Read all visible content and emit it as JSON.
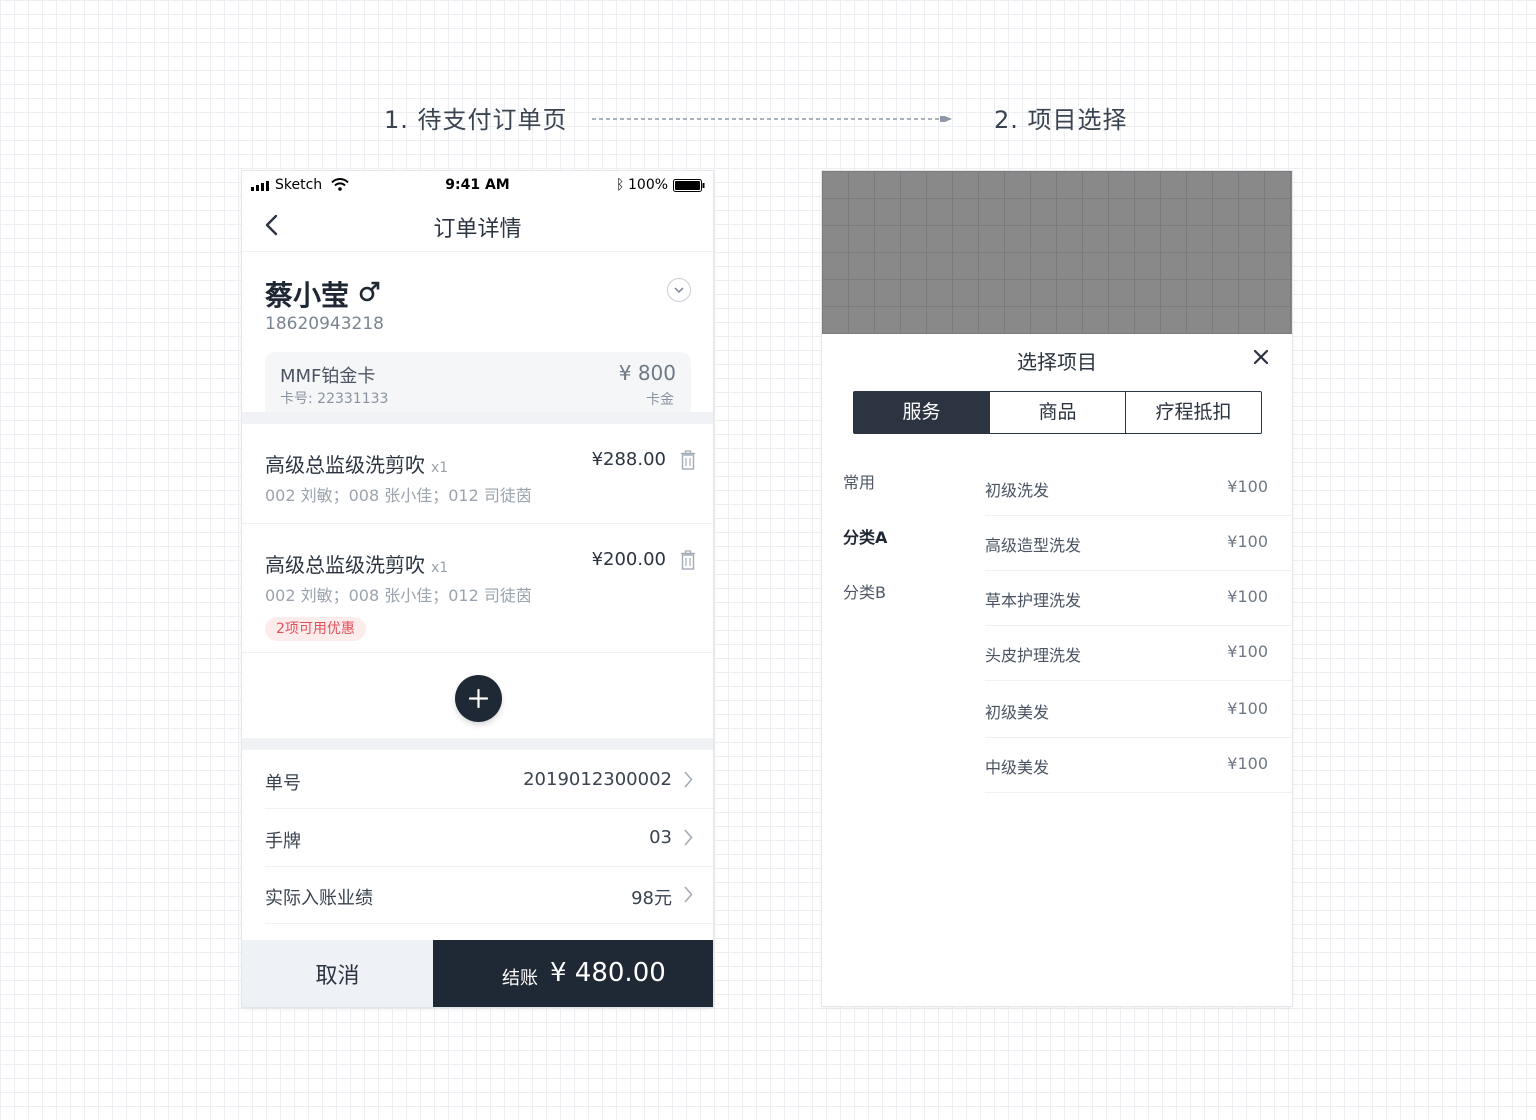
{
  "flow": {
    "step1_title": "1. 待支付订单页",
    "step2_title": "2. 项目选择"
  },
  "status_bar": {
    "carrier": "Sketch",
    "time": "9:41 AM",
    "battery": "100%"
  },
  "order_page": {
    "nav_title": "订单详情",
    "customer": {
      "name": "蔡小莹",
      "gender_symbol": "♂",
      "phone": "18620943218"
    },
    "card": {
      "name": "MMF铂金卡",
      "number": "卡号: 22331133",
      "amount": "¥ 800",
      "type": "卡金"
    },
    "items": [
      {
        "name": "高级总监级洗剪吹",
        "qty": "x1",
        "price": "¥288.00",
        "staff": "002 刘敏；008 张小佳；012 司徒茵",
        "badge": ""
      },
      {
        "name": "高级总监级洗剪吹",
        "qty": "x1",
        "price": "¥200.00",
        "staff": "002 刘敏；008 张小佳；012 司徒茵",
        "badge": "2项可用优惠"
      }
    ],
    "info_rows": [
      {
        "label": "单号",
        "value": "2019012300002"
      },
      {
        "label": "手牌",
        "value": "03"
      },
      {
        "label": "实际入账业绩",
        "value": "98元"
      }
    ],
    "cancel_label": "取消",
    "checkout_label": "结账",
    "checkout_amount": "¥ 480.00"
  },
  "select_page": {
    "title": "选择项目",
    "tabs": [
      {
        "label": "服务",
        "active": true
      },
      {
        "label": "商品",
        "active": false
      },
      {
        "label": "疗程抵扣",
        "active": false
      }
    ],
    "categories": [
      {
        "label": "常用",
        "active": false
      },
      {
        "label": "分类A",
        "active": true
      },
      {
        "label": "分类B",
        "active": false
      }
    ],
    "products": [
      {
        "name": "初级洗发",
        "price": "¥100"
      },
      {
        "name": "高级造型洗发",
        "price": "¥100"
      },
      {
        "name": "草本护理洗发",
        "price": "¥100"
      },
      {
        "name": "头皮护理洗发",
        "price": "¥100"
      },
      {
        "name": "初级美发",
        "price": "¥100"
      },
      {
        "name": "中级美发",
        "price": "¥100"
      }
    ]
  },
  "colors": {
    "primary_dark": "#1f2935",
    "badge_red": "#e4505a",
    "badge_bg": "#fdecec",
    "overlay_gray": "#898989"
  }
}
